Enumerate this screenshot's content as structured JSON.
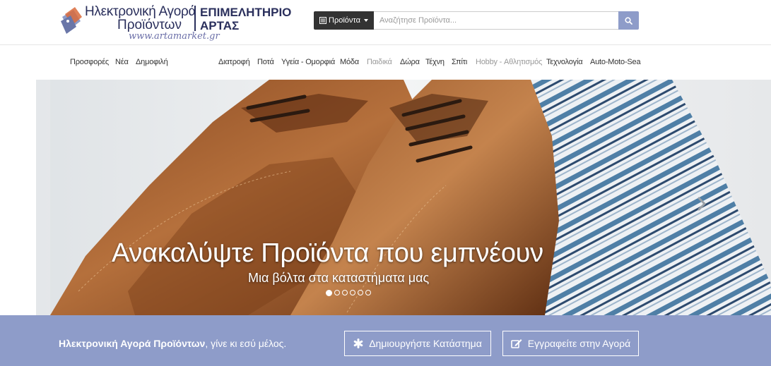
{
  "logo": {
    "title_line1": "Ηλεκτρονική Αγορά",
    "title_line2": "Προϊόντων",
    "url": "www.artamarket.gr",
    "chamber_line1": "ΕΠΙΜΕΛΗΤΗΡΙΟ",
    "chamber_line2": "ΑΡΤΑΣ"
  },
  "search": {
    "category_label": "Προϊόντα",
    "placeholder": "Αναζήτησε Προϊόντα...",
    "icon": "search-icon"
  },
  "nav": {
    "left": [
      "Προσφορές",
      "Νέα",
      "Δημοφιλή"
    ],
    "categories": [
      "Διατροφή",
      "Ποτά",
      "Υγεία - Ομορφιά",
      "Μόδα",
      "Παιδικά",
      "Δώρα",
      "Τέχνη",
      "Σπίτι",
      "Hobby - Αθλητισμός",
      "Τεχνολογία",
      "Auto-Moto-Sea"
    ]
  },
  "hero": {
    "title": "Ανακαλύψτε Προϊόντα που εμπνέουν",
    "subtitle": "Μια βόλτα στα καταστήματα μας",
    "slide_count": 6,
    "active_slide": 1
  },
  "band": {
    "text_bold": "Ηλεκτρονική Αγορά Προϊόντων",
    "text_rest": ", γίνε κι εσύ μέλος.",
    "create_store_label": "Δημιουργήστε Κατάστημα",
    "register_label": "Εγγραφείτε στην Αγορά"
  },
  "colors": {
    "accent": "#8e9cc9",
    "dark": "#333333",
    "brand_navy": "#2a2f5c"
  }
}
